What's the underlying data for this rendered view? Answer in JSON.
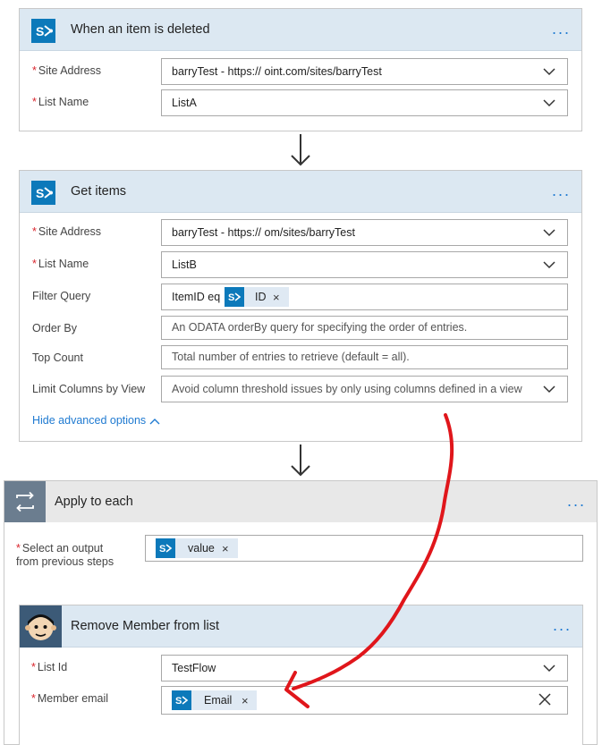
{
  "trigger": {
    "title": "When an item is deleted",
    "more": "...",
    "site_address_label": "Site Address",
    "site_address_value": "barryTest - https://                        oint.com/sites/barryTest",
    "list_name_label": "List Name",
    "list_name_value": "ListA"
  },
  "get_items": {
    "title": "Get items",
    "more": "...",
    "site_address_label": "Site Address",
    "site_address_value": "barryTest - https://                                  om/sites/barryTest",
    "list_name_label": "List Name",
    "list_name_value": "ListB",
    "filter_query_label": "Filter Query",
    "filter_query_prefix": "ItemID eq",
    "filter_token": "ID",
    "order_by_label": "Order By",
    "order_by_placeholder": "An ODATA orderBy query for specifying the order of entries.",
    "top_count_label": "Top Count",
    "top_count_placeholder": "Total number of entries to retrieve (default = all).",
    "limit_columns_label": "Limit Columns by View",
    "limit_columns_placeholder": "Avoid column threshold issues by only using columns defined in a view",
    "hide_advanced": "Hide advanced options"
  },
  "apply_each": {
    "title": "Apply to each",
    "more": "...",
    "output_label_line1": "Select an output",
    "output_label_line2": "from previous steps",
    "output_token": "value"
  },
  "remove_member": {
    "title": "Remove Member from list",
    "more": "...",
    "list_id_label": "List Id",
    "list_id_value": "TestFlow",
    "member_email_label": "Member email",
    "member_email_token": "Email"
  },
  "token_close": "×",
  "required_mark": "*",
  "colors": {
    "accent": "#1f7ad1",
    "header_blue": "#dce8f2",
    "sharepoint": "#0c79ba",
    "required": "#d9252d",
    "annotation_arrow": "#e0161b"
  },
  "icons": [
    "sharepoint-icon",
    "chevron-down-icon",
    "close-icon",
    "loop-icon",
    "mailchimp-icon",
    "arrow-down-icon",
    "chevron-up-icon"
  ]
}
